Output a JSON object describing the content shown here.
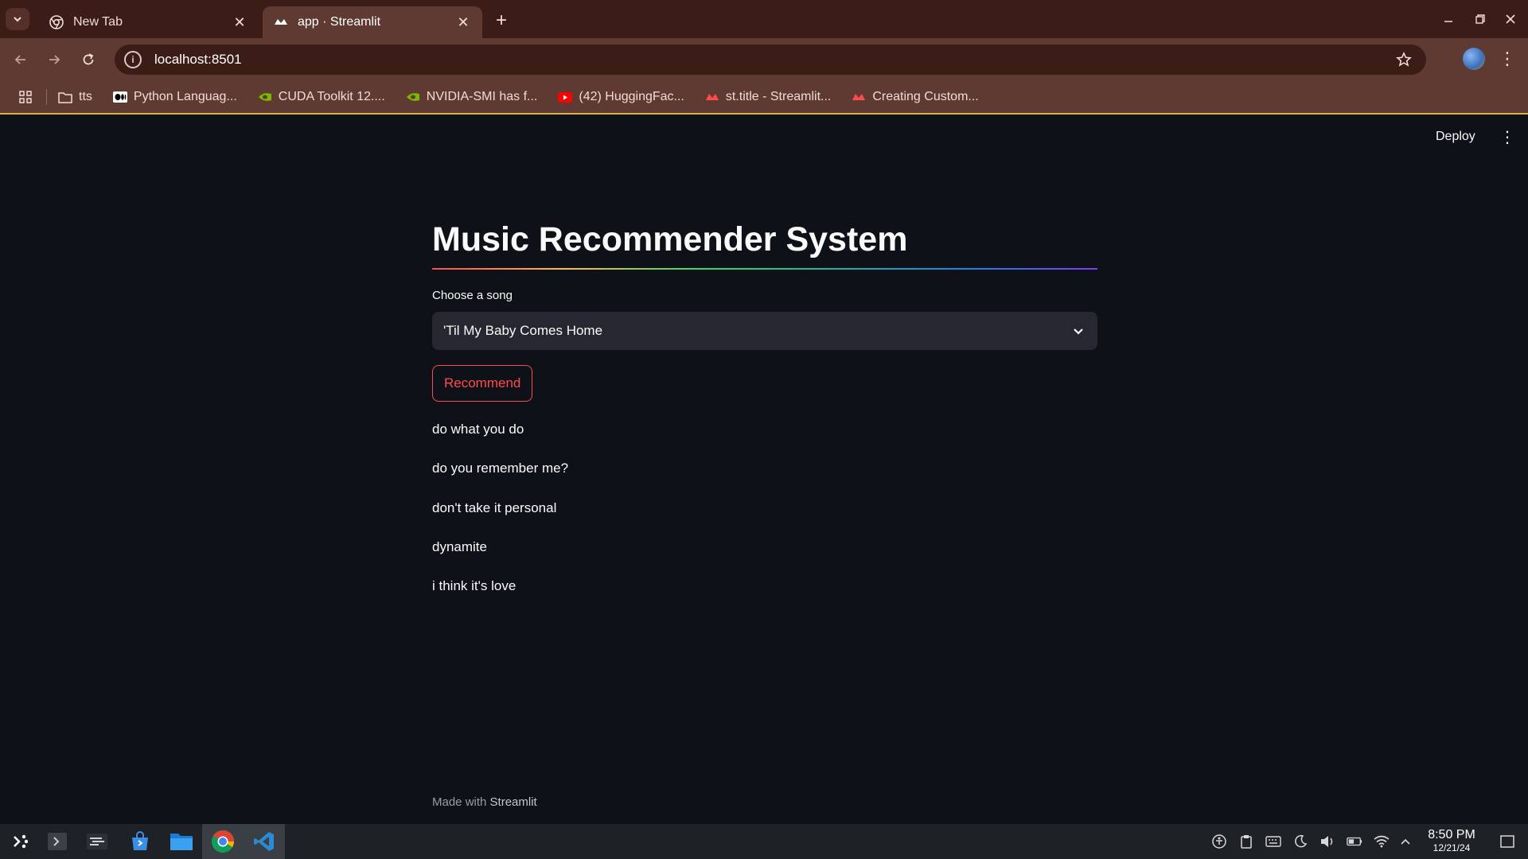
{
  "browser": {
    "tabs": [
      {
        "title": "New Tab",
        "active": false
      },
      {
        "title": "app · Streamlit",
        "active": true
      }
    ],
    "url": "localhost:8501",
    "bookmarks": [
      {
        "label": "tts",
        "icon": "folder-icon"
      },
      {
        "label": "Python Languag...",
        "icon": "medium-icon"
      },
      {
        "label": "CUDA Toolkit 12....",
        "icon": "nvidia-icon"
      },
      {
        "label": "NVIDIA-SMI has f...",
        "icon": "nvidia-icon"
      },
      {
        "label": "(42) HuggingFac...",
        "icon": "youtube-icon"
      },
      {
        "label": "st.title - Streamlit...",
        "icon": "streamlit-icon"
      },
      {
        "label": "Creating Custom...",
        "icon": "streamlit-icon"
      }
    ]
  },
  "app": {
    "deploy_label": "Deploy",
    "title": "Music Recommender System",
    "select_label": "Choose a song",
    "selected_song": "'Til My Baby Comes Home",
    "button_label": "Recommend",
    "recommendations": [
      "do what you do",
      "do you remember me?",
      "don't take it personal",
      "dynamite",
      "i think it's love"
    ],
    "footer_prefix": "Made with",
    "footer_brand": "Streamlit",
    "colors": {
      "primary": "#ff4b4b",
      "background": "#0e1117",
      "widget": "#262730"
    }
  },
  "taskbar": {
    "time": "8:50 PM",
    "date": "12/21/24"
  }
}
